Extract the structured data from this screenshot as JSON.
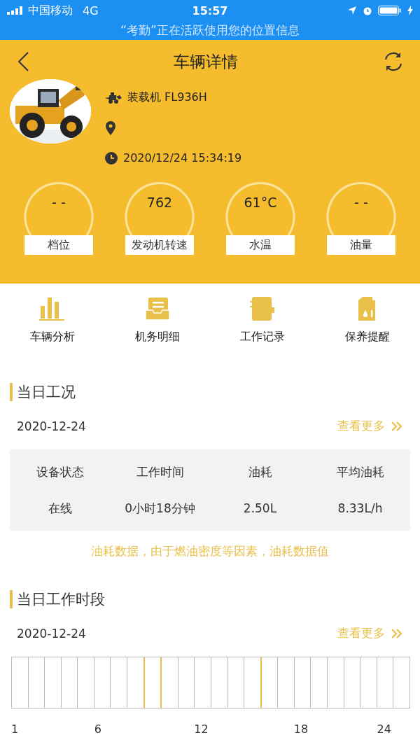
{
  "status_bar": {
    "carrier": "中国移动",
    "network": "4G",
    "time": "15:57"
  },
  "location_banner": "“考勤”正在活跃使用您的位置信息",
  "header": {
    "title": "车辆详情"
  },
  "vehicle": {
    "model": "装载机 FL936H",
    "timestamp": "2020/12/24 15:34:19"
  },
  "gauges": [
    {
      "value": "- -",
      "label": "档位"
    },
    {
      "value": "762",
      "label": "发动机转速"
    },
    {
      "value": "61°C",
      "label": "水温"
    },
    {
      "value": "- -",
      "label": "油量"
    }
  ],
  "shortcuts": [
    {
      "kind": "chart",
      "label": "车辆分析"
    },
    {
      "kind": "tray",
      "label": "机务明细"
    },
    {
      "kind": "notebook",
      "label": "工作记录"
    },
    {
      "kind": "oilcan",
      "label": "保养提醒"
    }
  ],
  "daily_status": {
    "title": "当日工况",
    "date": "2020-12-24",
    "more": "查看更多",
    "columns": [
      "设备状态",
      "工作时间",
      "油耗",
      "平均油耗"
    ],
    "row": [
      "在线",
      "0小时18分钟",
      "2.50L",
      "8.33L/h"
    ],
    "notice": "油耗数据，由于燃油密度等因素，油耗数据值"
  },
  "work_periods": {
    "title": "当日工作时段",
    "date": "2020-12-24",
    "more": "查看更多",
    "hours": [
      {
        "marked": false
      },
      {
        "marked": false
      },
      {
        "marked": false
      },
      {
        "marked": false
      },
      {
        "marked": false
      },
      {
        "marked": false
      },
      {
        "marked": false
      },
      {
        "marked": false
      },
      {
        "marked": true
      },
      {
        "marked": true
      },
      {
        "marked": false
      },
      {
        "marked": false
      },
      {
        "marked": false
      },
      {
        "marked": false
      },
      {
        "marked": false
      },
      {
        "marked": true
      },
      {
        "marked": false
      },
      {
        "marked": false
      },
      {
        "marked": false
      },
      {
        "marked": false
      },
      {
        "marked": false
      },
      {
        "marked": false
      },
      {
        "marked": false
      },
      {
        "marked": false
      }
    ],
    "axis_labels": [
      "1",
      "6",
      "12",
      "18",
      "24"
    ]
  }
}
